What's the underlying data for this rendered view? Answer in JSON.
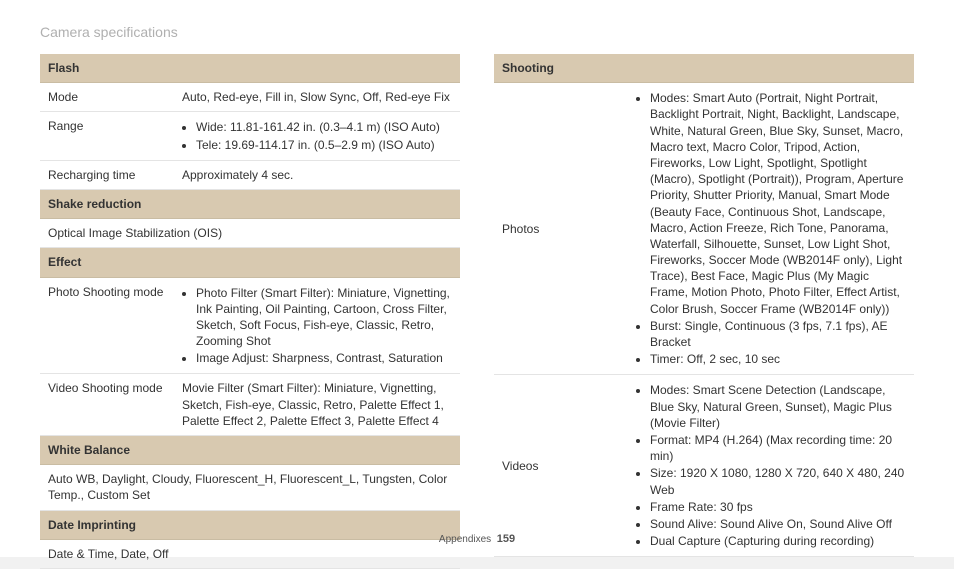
{
  "page": {
    "title": "Camera specifications",
    "footer_section": "Appendixes",
    "footer_page": "159"
  },
  "left": {
    "flash": {
      "header": "Flash",
      "mode_label": "Mode",
      "mode_value": "Auto, Red-eye, Fill in, Slow Sync, Off, Red-eye Fix",
      "range_label": "Range",
      "range_b1": "Wide: 11.81-161.42 in. (0.3–4.1 m) (ISO Auto)",
      "range_b2": "Tele: 19.69-114.17 in. (0.5–2.9 m) (ISO Auto)",
      "recharge_label": "Recharging time",
      "recharge_value": "Approximately 4 sec."
    },
    "shake": {
      "header": "Shake reduction",
      "value": "Optical Image Stabilization (OIS)"
    },
    "effect": {
      "header": "Effect",
      "photo_label": "Photo Shooting mode",
      "photo_b1": "Photo Filter (Smart Filter): Miniature, Vignetting, Ink Painting, Oil Painting, Cartoon, Cross Filter, Sketch, Soft Focus, Fish-eye, Classic, Retro, Zooming Shot",
      "photo_b2": "Image Adjust: Sharpness, Contrast, Saturation",
      "video_label": "Video Shooting mode",
      "video_value": "Movie Filter (Smart Filter): Miniature, Vignetting, Sketch, Fish-eye, Classic, Retro, Palette Effect 1, Palette Effect 2, Palette Effect 3, Palette Effect 4"
    },
    "wb": {
      "header": "White Balance",
      "value": "Auto WB, Daylight, Cloudy, Fluorescent_H, Fluorescent_L, Tungsten, Color Temp., Custom Set"
    },
    "date": {
      "header": "Date Imprinting",
      "value": "Date & Time, Date, Off"
    }
  },
  "right": {
    "shooting": {
      "header": "Shooting",
      "photos_label": "Photos",
      "photos_b1": "Modes: Smart Auto (Portrait, Night Portrait, Backlight Portrait, Night, Backlight, Landscape, White, Natural Green, Blue Sky, Sunset, Macro, Macro text, Macro Color, Tripod, Action, Fireworks, Low Light, Spotlight, Spotlight (Macro), Spotlight (Portrait)), Program, Aperture Priority, Shutter Priority, Manual, Smart Mode (Beauty Face, Continuous Shot, Landscape, Macro, Action Freeze, Rich Tone, Panorama, Waterfall, Silhouette, Sunset, Low Light Shot, Fireworks, Soccer Mode (WB2014F only), Light Trace), Best Face, Magic Plus (My Magic Frame, Motion Photo, Photo Filter, Effect Artist, Color Brush, Soccer Frame (WB2014F only))",
      "photos_b2": "Burst: Single, Continuous (3 fps, 7.1 fps), AE Bracket",
      "photos_b3": "Timer: Off, 2 sec, 10 sec",
      "videos_label": "Videos",
      "videos_b1": "Modes: Smart Scene Detection (Landscape, Blue Sky, Natural Green, Sunset), Magic Plus (Movie Filter)",
      "videos_b2": "Format: MP4 (H.264) (Max recording time: 20 min)",
      "videos_b3": "Size: 1920 X 1080, 1280 X 720, 640 X 480, 240 Web",
      "videos_b4": "Frame Rate: 30 fps",
      "videos_b5": "Sound Alive: Sound Alive On, Sound Alive Off",
      "videos_b6": "Dual Capture (Capturing during recording)"
    }
  }
}
